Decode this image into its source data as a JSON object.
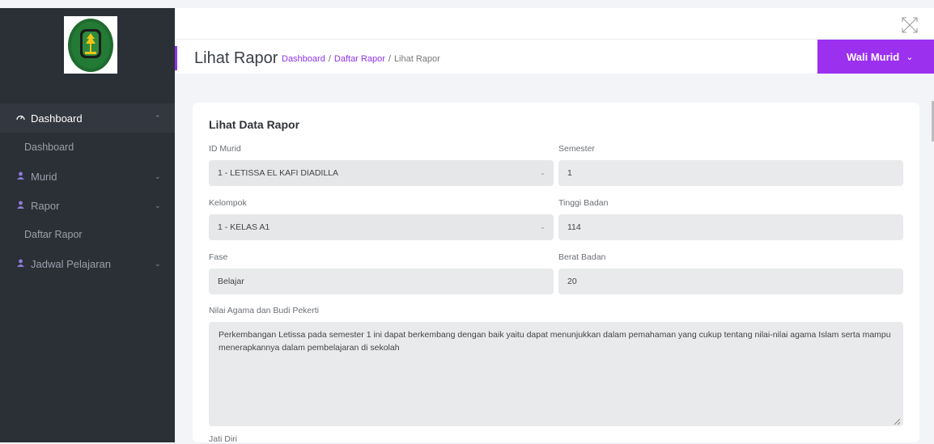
{
  "sidebar": {
    "items": [
      {
        "label": "Dashboard",
        "icon": "tachometer-icon",
        "expanded": true
      },
      {
        "label": "Dashboard",
        "sub": true
      },
      {
        "label": "Murid",
        "icon": "user-icon"
      },
      {
        "label": "Rapor",
        "icon": "user-icon"
      },
      {
        "label": "Daftar Rapor",
        "sub": true
      },
      {
        "label": "Jadwal Pelajaran",
        "icon": "user-icon"
      }
    ]
  },
  "header": {
    "title": "Lihat Rapor",
    "breadcrumb": [
      "Dashboard",
      "Daftar Rapor",
      "Lihat Rapor"
    ],
    "user_label": "Wali Murid"
  },
  "form": {
    "title": "Lihat Data Rapor",
    "id_murid_label": "ID Murid",
    "id_murid_value": "1 - LETISSA EL KAFI DIADILLA",
    "semester_label": "Semester",
    "semester_value": "1",
    "kelompok_label": "Kelompok",
    "kelompok_value": "1 - KELAS A1",
    "tinggi_label": "Tinggi Badan",
    "tinggi_value": "114",
    "fase_label": "Fase",
    "fase_value": "Belajar",
    "berat_label": "Berat Badan",
    "berat_value": "20",
    "agama_label": "Nilai Agama dan Budi Pekerti",
    "agama_value": "Perkembangan Letissa pada semester 1 ini dapat berkembang dengan baik yaitu dapat menunjukkan dalam pemahaman yang cukup tentang nilai-nilai agama Islam serta mampu menerapkannya dalam pembelajaran di sekolah",
    "next_label": "Jati Diri"
  },
  "colors": {
    "accent": "#9b30ef",
    "sidebar_bg": "#2b2f36"
  }
}
